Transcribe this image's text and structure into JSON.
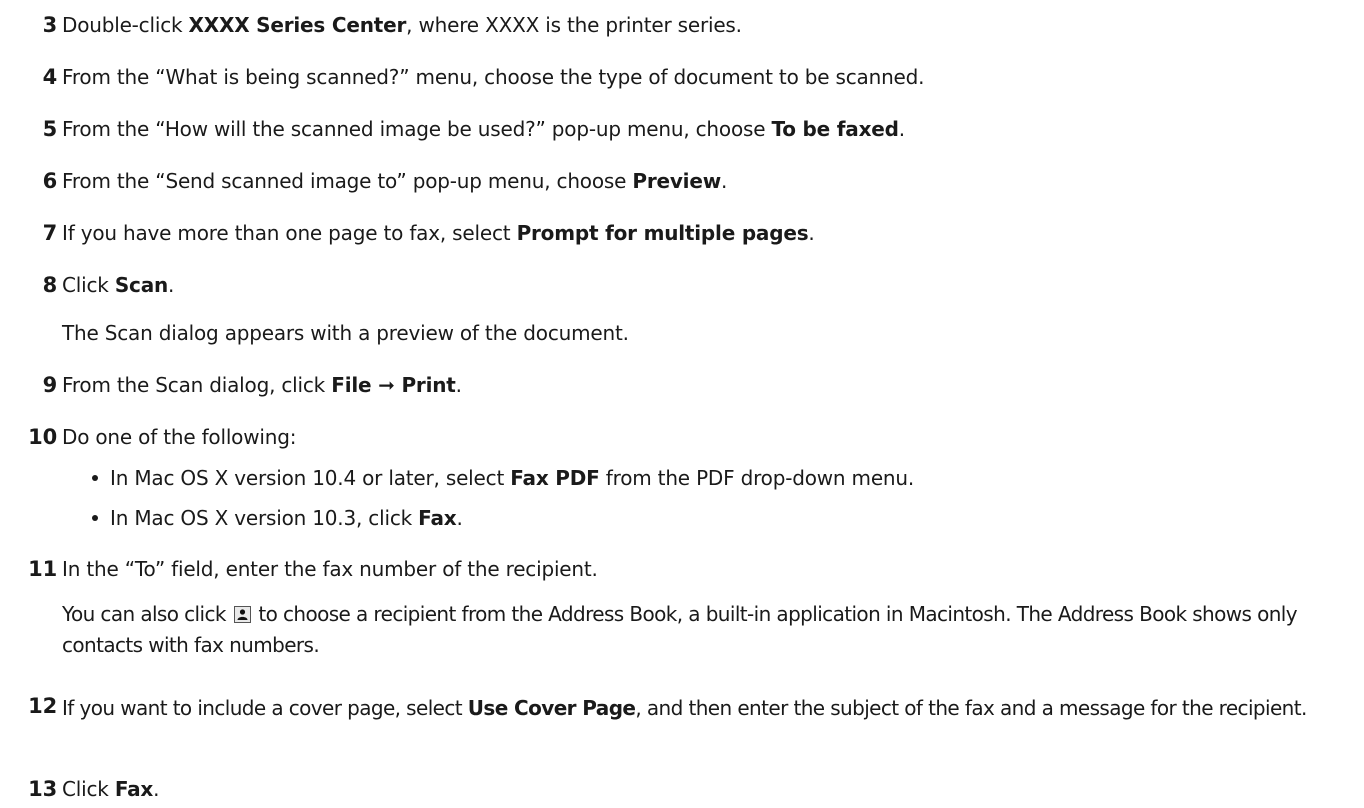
{
  "steps": [
    {
      "num": "3",
      "pre": "Double-click ",
      "bold": "XXXX Series Center",
      "post": ", where XXXX is the printer series."
    },
    {
      "num": "4",
      "text": "From the “What is being scanned?” menu, choose the type of document to be scanned."
    },
    {
      "num": "5",
      "pre": "From the “How will the scanned image be used?” pop-up menu, choose ",
      "bold": "To be faxed",
      "post": "."
    },
    {
      "num": "6",
      "pre": "From the “Send scanned image to” pop-up menu, choose ",
      "bold": "Preview",
      "post": "."
    },
    {
      "num": "7",
      "pre": "If you have more than one page to fax, select ",
      "bold": "Prompt for multiple pages",
      "post": "."
    },
    {
      "num": "8",
      "pre": "Click ",
      "bold": "Scan",
      "post": ".",
      "note": "The Scan dialog appears with a preview of the document."
    },
    {
      "num": "9",
      "pre": "From the Scan dialog, click ",
      "bold": "File ➞ Print",
      "post": "."
    },
    {
      "num": "10",
      "text": "Do one of the following:",
      "bullets": [
        {
          "pre": "In Mac OS X version 10.4 or later, select ",
          "bold": "Fax PDF",
          "post": " from the PDF drop-down menu."
        },
        {
          "pre": "In Mac OS X version 10.3, click ",
          "bold": "Fax",
          "post": "."
        }
      ]
    },
    {
      "num": "11",
      "text": "In the “To” field, enter the fax number of the recipient.",
      "note_pre": "You can also click ",
      "note_icon": "address-book-icon",
      "note_post": " to choose a recipient from the Address Book, a built-in application in Macintosh. The Address Book shows only contacts with fax numbers."
    },
    {
      "num": "12",
      "pre": "If you want to include a cover page, select ",
      "bold": "Use Cover Page",
      "post": ", and then enter the subject of the fax and a message for the recipient."
    },
    {
      "num": "13",
      "pre": "Click ",
      "bold": "Fax",
      "post": "."
    }
  ]
}
